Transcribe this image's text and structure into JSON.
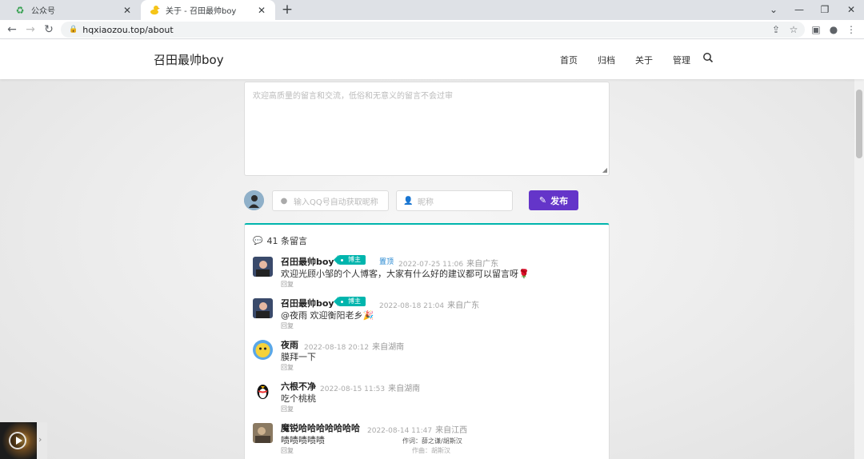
{
  "browser": {
    "tabs": [
      {
        "title": "公众号",
        "active": false,
        "icon": "recycle-icon"
      },
      {
        "title": "关于 - 召田最帅boy",
        "active": true,
        "icon": "duck-icon"
      }
    ],
    "url": "hqxiaozou.top/about"
  },
  "site": {
    "brand": "召田最帅boy",
    "nav": [
      "首页",
      "归档",
      "关于",
      "管理"
    ]
  },
  "form": {
    "textarea_placeholder": "欢迎高质量的留言和交流，低俗和无意义的留言不会过审",
    "qq_placeholder": "输入QQ号自动获取昵称",
    "nick_placeholder": "昵称",
    "publish_label": "发布"
  },
  "comments": {
    "count_label": "41 条留言",
    "items": [
      {
        "name": "召田最帅boy",
        "badge": "博主",
        "pinned": "置顶",
        "time": "2022-07-25 11:06",
        "location": "来自广东",
        "body": "欢迎光顾小邹的个人博客，大家有什么好的建议都可以留言呀🌹",
        "reply": "回复"
      },
      {
        "name": "召田最帅boy",
        "badge": "博主",
        "pinned": "",
        "time": "2022-08-18 21:04",
        "location": "来自广东",
        "body": "@夜雨 欢迎衡阳老乡🎉",
        "reply": "回复"
      },
      {
        "name": "夜雨",
        "badge": "",
        "pinned": "",
        "time": "2022-08-18 20:12",
        "location": "来自湖南",
        "body": "膜拜一下",
        "reply": "回复"
      },
      {
        "name": "六根不净",
        "badge": "",
        "pinned": "",
        "time": "2022-08-15 11:53",
        "location": "来自湖南",
        "body": "吃个桃桃",
        "reply": "回复"
      },
      {
        "name": "魔锐哈哈哈哈哈哈哈",
        "badge": "",
        "pinned": "",
        "time": "2022-08-14 11:47",
        "location": "来自江西",
        "body": "啧啧啧啧啧",
        "reply": "回复"
      }
    ]
  },
  "player": {
    "lyrics_line1": "作词：薛之谦/胡斯汉",
    "lyrics_line2": "作曲：胡斯汉"
  },
  "colors": {
    "accent": "#6435c9",
    "teal": "#00b5ad",
    "link": "#2185d0"
  }
}
